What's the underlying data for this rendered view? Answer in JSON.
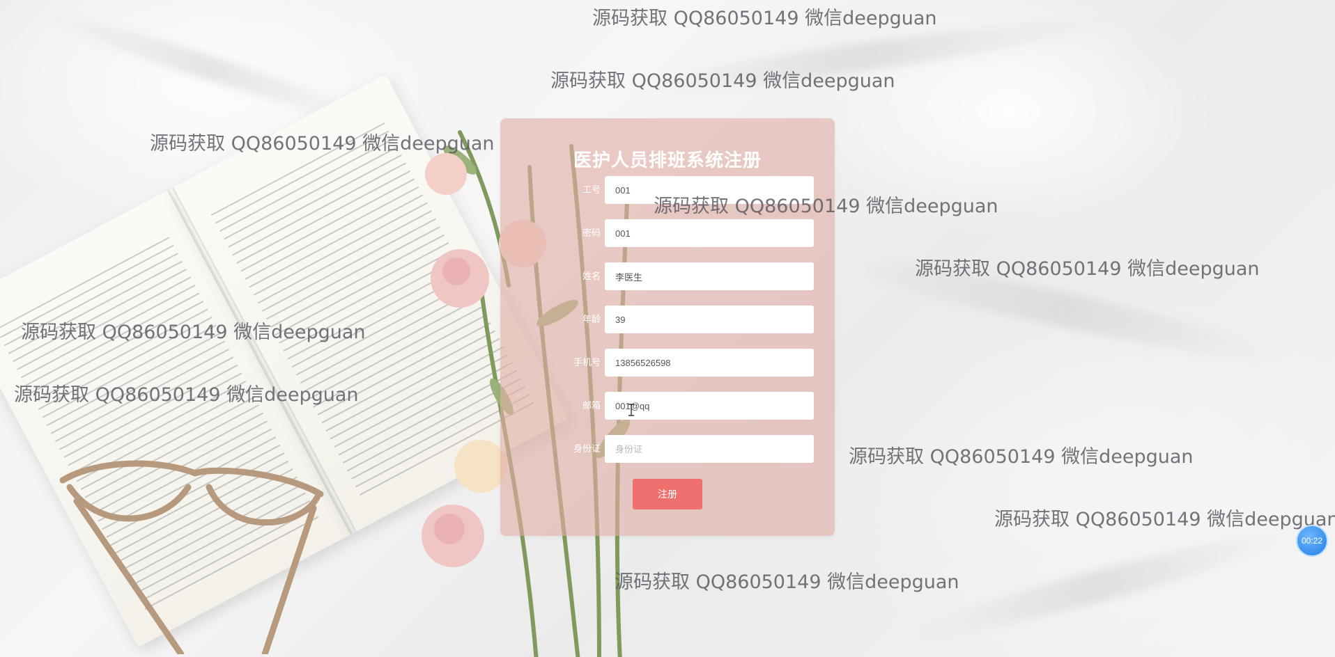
{
  "form": {
    "title": "医护人员排班系统注册",
    "fields": [
      {
        "label": "工号",
        "value": "001",
        "placeholder": ""
      },
      {
        "label": "密码",
        "value": "001",
        "placeholder": ""
      },
      {
        "label": "姓名",
        "value": "李医生",
        "placeholder": ""
      },
      {
        "label": "年龄",
        "value": "39",
        "placeholder": ""
      },
      {
        "label": "手机号",
        "value": "13856526598",
        "placeholder": ""
      },
      {
        "label": "邮箱",
        "value": "001@qq",
        "placeholder": ""
      },
      {
        "label": "身份证",
        "value": "",
        "placeholder": "身份证"
      }
    ],
    "submit_label": "注册"
  },
  "watermark_text": "源码获取 QQ86050149 微信deepguan",
  "timer": {
    "value": "00:22"
  },
  "colors": {
    "panel": "#e1afa5",
    "button": "#ef6f6c",
    "timer": "#1f7fe6"
  },
  "icons": [
    "text-cursor-icon"
  ]
}
